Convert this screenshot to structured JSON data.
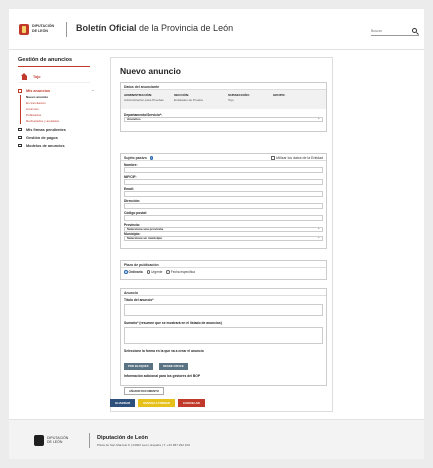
{
  "header": {
    "logo_text": "DIPUTACIÓN DE LEÓN",
    "title_bold": "Boletín Oficial",
    "title_rest": " de la Provincia de León",
    "search_placeholder": "Buscar"
  },
  "sidebar": {
    "title": "Gestión de anuncios",
    "home": "Tojo",
    "group": "Mis anuncios",
    "group_toggle": "−",
    "sub_items": [
      {
        "label": "Nuevo anuncio",
        "active": true
      },
      {
        "label": "En tramitación"
      },
      {
        "label": "Anuncios"
      },
      {
        "label": "Publicados"
      },
      {
        "label": "Rechazados y anulados"
      }
    ],
    "links": [
      {
        "label": "Mis firmas pendientes"
      },
      {
        "label": "Gestión de pagos"
      },
      {
        "label": "Modelos de anuncios"
      }
    ]
  },
  "main": {
    "title": "Nuevo anuncio",
    "anunciante": {
      "title": "Datos del anunciante",
      "administracion_label": "ADMINISTRACIÓN:",
      "administracion_value": "Administración para Pruebas",
      "seccion_label": "SECCIÓN:",
      "seccion_value": "Entidades de Prueba",
      "subseccion_label": "SUBSECCIÓN:",
      "subseccion_value": "Tojo",
      "grupo_label": "GRUPO:",
      "departamento_label": "Departamento/Servicio*:",
      "departamento_value": "Anuncios"
    },
    "sujeto": {
      "title": "Sujeto pasivo",
      "use_entity_label": "Utilizar los datos de la Entidad",
      "nombre_label": "Nombre:",
      "nif_label": "NIF/CIF:",
      "email_label": "Email:",
      "direccion_label": "Dirección:",
      "cp_label": "Código postal:",
      "provincia_label": "Provincia:",
      "provincia_value": "Seleccione una provincia",
      "municipio_label": "Municipio:",
      "municipio_value": "Seleccione un municipio"
    },
    "plazo": {
      "title": "Plazo de publicación",
      "options": [
        "Ordinaria",
        "Urgente",
        "Fecha específica"
      ]
    },
    "anuncio": {
      "title": "Anuncio",
      "titulo_label": "Título del anuncio*",
      "sumario_label": "Sumario* (resumen que se mostrará en el listado de anuncios)",
      "firma_label": "Seleccione la forma en la que va a crear el anuncio",
      "por_bloques": "POR BLOQUES",
      "desde_office": "DESDE OFFICE",
      "info_label": "Información adicional para los gestores del BOP",
      "anadir_doc": "AÑADIR DOCUMENTO"
    }
  },
  "actions": {
    "guardar": "GUARDAR",
    "envio": "ENVIAR A FIRMAR",
    "cancelar": "CANCELAR"
  },
  "footer": {
    "logo_text": "DIPUTACIÓN DE LEÓN",
    "title": "Diputación de León",
    "address": "Plaza de San Marcelo 6 | 24002 León, España | T. +34 987 292 100"
  },
  "colors": {
    "brand_red": "#c0392b",
    "button_dark": "#5a7383",
    "guardar_blue": "#2c4f7c",
    "envio_yellow": "#e6c11c"
  }
}
